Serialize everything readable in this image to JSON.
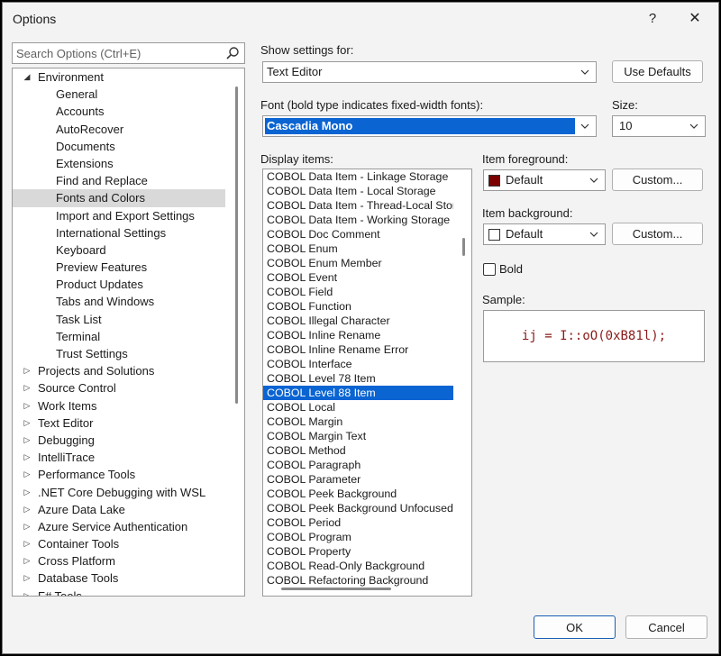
{
  "window": {
    "title": "Options",
    "help_label": "?",
    "close_label": "✕"
  },
  "search": {
    "placeholder": "Search Options (Ctrl+E)"
  },
  "tree": {
    "items": [
      {
        "label": "Environment",
        "level": 0,
        "state": "expanded"
      },
      {
        "label": "General",
        "level": 1
      },
      {
        "label": "Accounts",
        "level": 1
      },
      {
        "label": "AutoRecover",
        "level": 1
      },
      {
        "label": "Documents",
        "level": 1
      },
      {
        "label": "Extensions",
        "level": 1
      },
      {
        "label": "Find and Replace",
        "level": 1
      },
      {
        "label": "Fonts and Colors",
        "level": 1,
        "selected": true
      },
      {
        "label": "Import and Export Settings",
        "level": 1
      },
      {
        "label": "International Settings",
        "level": 1
      },
      {
        "label": "Keyboard",
        "level": 1
      },
      {
        "label": "Preview Features",
        "level": 1
      },
      {
        "label": "Product Updates",
        "level": 1
      },
      {
        "label": "Tabs and Windows",
        "level": 1
      },
      {
        "label": "Task List",
        "level": 1
      },
      {
        "label": "Terminal",
        "level": 1
      },
      {
        "label": "Trust Settings",
        "level": 1
      },
      {
        "label": "Projects and Solutions",
        "level": 0,
        "state": "collapsed"
      },
      {
        "label": "Source Control",
        "level": 0,
        "state": "collapsed"
      },
      {
        "label": "Work Items",
        "level": 0,
        "state": "collapsed"
      },
      {
        "label": "Text Editor",
        "level": 0,
        "state": "collapsed"
      },
      {
        "label": "Debugging",
        "level": 0,
        "state": "collapsed"
      },
      {
        "label": "IntelliTrace",
        "level": 0,
        "state": "collapsed"
      },
      {
        "label": "Performance Tools",
        "level": 0,
        "state": "collapsed"
      },
      {
        "label": ".NET Core Debugging with WSL",
        "level": 0,
        "state": "collapsed"
      },
      {
        "label": "Azure Data Lake",
        "level": 0,
        "state": "collapsed"
      },
      {
        "label": "Azure Service Authentication",
        "level": 0,
        "state": "collapsed"
      },
      {
        "label": "Container Tools",
        "level": 0,
        "state": "collapsed"
      },
      {
        "label": "Cross Platform",
        "level": 0,
        "state": "collapsed"
      },
      {
        "label": "Database Tools",
        "level": 0,
        "state": "collapsed"
      },
      {
        "label": "F# Tools",
        "level": 0,
        "state": "collapsed"
      }
    ]
  },
  "settings": {
    "show_settings_label": "Show settings for:",
    "show_settings_value": "Text Editor",
    "use_defaults_label": "Use Defaults",
    "font_label": "Font (bold type indicates fixed-width fonts):",
    "font_value": "Cascadia Mono",
    "size_label": "Size:",
    "size_value": "10",
    "display_items_label": "Display items:",
    "display_items": [
      "COBOL Data Item - Linkage Storage",
      "COBOL Data Item - Local Storage",
      "COBOL Data Item - Thread-Local Storage",
      "COBOL Data Item - Working Storage",
      "COBOL Doc Comment",
      "COBOL Enum",
      "COBOL Enum Member",
      "COBOL Event",
      "COBOL Field",
      "COBOL Function",
      "COBOL Illegal Character",
      "COBOL Inline Rename",
      "COBOL Inline Rename Error",
      "COBOL Interface",
      "COBOL Level 78 Item",
      "COBOL Level 88 Item",
      "COBOL Local",
      "COBOL Margin",
      "COBOL Margin Text",
      "COBOL Method",
      "COBOL Paragraph",
      "COBOL Parameter",
      "COBOL Peek Background",
      "COBOL Peek Background Unfocused",
      "COBOL Period",
      "COBOL Program",
      "COBOL Property",
      "COBOL Read-Only Background",
      "COBOL Refactoring Background"
    ],
    "selected_display_item": "COBOL Level 88 Item",
    "item_foreground_label": "Item foreground:",
    "item_foreground_value": "Default",
    "item_foreground_color": "#7b0000",
    "item_background_label": "Item background:",
    "item_background_value": "Default",
    "item_background_color": "#ffffff",
    "custom_label": "Custom...",
    "bold_label": "Bold",
    "bold_checked": false,
    "sample_label": "Sample:",
    "sample_text": "ij = I::oO(0xB81l);",
    "sample_color": "#8b1a1a"
  },
  "footer": {
    "ok_label": "OK",
    "cancel_label": "Cancel"
  },
  "colors": {
    "selection": "#0a64d2",
    "tree_selection": "#d9d9d9",
    "dialog_bg": "#f3f3f3"
  }
}
